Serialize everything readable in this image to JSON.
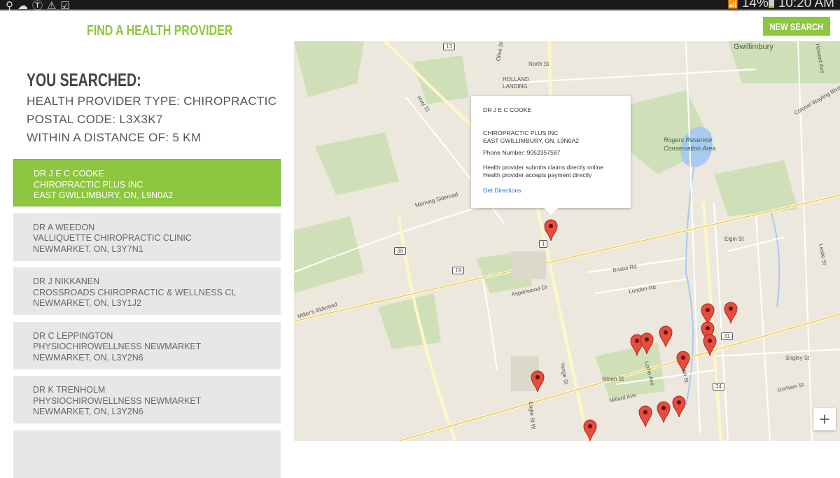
{
  "status_bar": {
    "icons": [
      "location-icon",
      "cloud-upload-icon",
      "nyt-icon",
      "warning-icon",
      "checkbox-icon"
    ],
    "battery": "14%",
    "time": "10:20 AM"
  },
  "header": {
    "title": "FIND A HEALTH PROVIDER",
    "new_search": "NEW SEARCH"
  },
  "search": {
    "heading": "YOU SEARCHED:",
    "type": "HEALTH PROVIDER TYPE: CHIROPRACTIC",
    "postal": "POSTAL CODE: L3X3K7",
    "distance": "WITHIN A DISTANCE OF: 5 KM"
  },
  "results": [
    {
      "name": "DR J E C COOKE",
      "clinic": "CHIROPRACTIC PLUS INC",
      "address": "EAST GWILLIMBURY, ON, L9N0A2",
      "active": true
    },
    {
      "name": "DR A WEEDON",
      "clinic": "VALLIQUETTE CHIROPRACTIC CLINIC",
      "address": "NEWMARKET, ON, L3Y7N1"
    },
    {
      "name": "DR J NIKKANEN",
      "clinic": "CROSSROADS CHIROPRACTIC & WELLNESS CL",
      "address": "NEWMARKET, ON, L3Y1J2"
    },
    {
      "name": "DR C LEPPINGTON",
      "clinic": "PHYSIOCHIROWELLNESS NEWMARKET",
      "address": "NEWMARKET, ON, L3Y2N6"
    },
    {
      "name": "DR K TRENHOLM",
      "clinic": "PHYSIOCHIROWELLNESS NEWMARKET",
      "address": "NEWMARKET, ON, L3Y2N6"
    }
  ],
  "popup": {
    "name": "DR J E C COOKE",
    "clinic": "CHIROPRACTIC PLUS INC",
    "address": "EAST GWILLIMBURY, ON, L9N0A2",
    "phone": "Phone Number: 9052357587",
    "note1": "Health provider submits claims directly online",
    "note2": "Health provider accepts payment directly",
    "directions": "Get Directions"
  },
  "map": {
    "labels": {
      "gwillimbury": "Gwillimbury",
      "holland": "HOLLAND",
      "landing": "LANDING",
      "rogers1": "Rogers Reservoir",
      "rogers2": "Conservation Area",
      "morning": "Morning Sideroad",
      "millers": "Miller's Sideroad",
      "bristol": "Bristol Rd",
      "london": "London Rd",
      "aspenwood": "Aspenwood Dr",
      "yonge": "Yonge St",
      "main": "Main St",
      "elgin": "Elgin St",
      "gorham": "Gorham St",
      "millard": "Millard Ave",
      "srigley": "Srigley St",
      "leslie": "Leslie St",
      "colonel": "Colonel Wayling Blvd",
      "howard": "Howard Ave",
      "north": "North St",
      "olive": "Olive St",
      "hwy11": "Hwy 11",
      "eagle": "Eagle St W",
      "lorne": "Lorne Ave",
      "isleen": "Isleen St"
    },
    "shields": [
      "13",
      "1",
      "19",
      "38",
      "31",
      "34"
    ],
    "zoom_in": "+",
    "pin_color": "#e74c3c"
  }
}
